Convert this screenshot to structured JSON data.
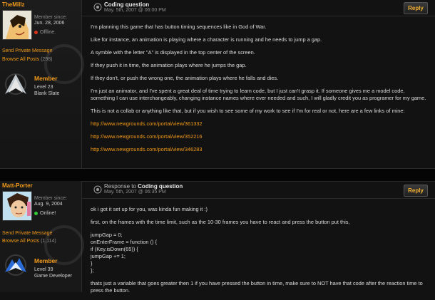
{
  "post1": {
    "user": {
      "name": "TheMillz",
      "member_since_label": "Member since:",
      "member_date": "Jun. 28, 2006",
      "status": "Offline.",
      "status_color": "#d9331a",
      "send_pm": "Send Private Message",
      "browse_posts": "Browse All Posts",
      "post_count": "(298)",
      "rank_title": "Member",
      "level": "Level 23",
      "rank_name": "Blank Slate"
    },
    "title": "Coding question",
    "date": "May. 5th, 2007 @ 06:00 PM",
    "reply_label": "Reply",
    "paragraphs": [
      "I'm planning this game that has button timing sequences like in God of War.",
      "Like for instance, an animation is playing where a character is running and he needs to jump a gap.",
      "A symble with the letter \"A\" is displayed in the top center of the screen.",
      "If they push it in time, the animation plays where he jumps the gap.",
      "If they don't, or push the wrong one, the animation plays where he falls and dies.",
      "I'm just an animator, and I've spent a great deal of time trying to learn code, but I just can't grasp it. If someone gives me a model code, something I can use interchangeably, changing instance names where ever needed and such, I will gladly credit you as programer for my game.",
      "This is not a collab or anything like that, but if you wish to see some of my work to see if I'm for real or not, here are a few links of mine:"
    ],
    "links": [
      "http://www.newgrounds.com/portal/view/361332",
      "http://www.newgrounds.com/portal/view/352216",
      "http://www.newgrounds.com/portal/view/346283"
    ]
  },
  "post2": {
    "user": {
      "name": "Matt-Porter",
      "member_since_label": "Member since:",
      "member_date": "Aug. 9, 2004",
      "status": "Online!",
      "status_color": "#33cc33",
      "send_pm": "Send Private Message",
      "browse_posts": "Browse All Posts",
      "post_count": "(1,114)",
      "rank_title": "Member",
      "level": "Level 39",
      "rank_name": "Game Developer"
    },
    "title_prefix": "Response to",
    "title": "Coding question",
    "date": "May. 5th, 2007 @ 06:35 PM",
    "reply_label": "Reply",
    "paragraphs": [
      "ok i got it set up for you, was kinda fun making it :)",
      "first, on the frames with the time limit, such as the 10-30 frames you have to react and press the button put this,"
    ],
    "code": [
      "jumpGap = 0;",
      "onEnterFrame = function () {",
      "if (Key.isDown(65)) {",
      "jumpGap += 1;",
      "}",
      "};"
    ],
    "after": "thats just a variable that goes greater then 1 if you have pressed the button in time, make sure to NOT have that code after the reaction time to press the button."
  }
}
